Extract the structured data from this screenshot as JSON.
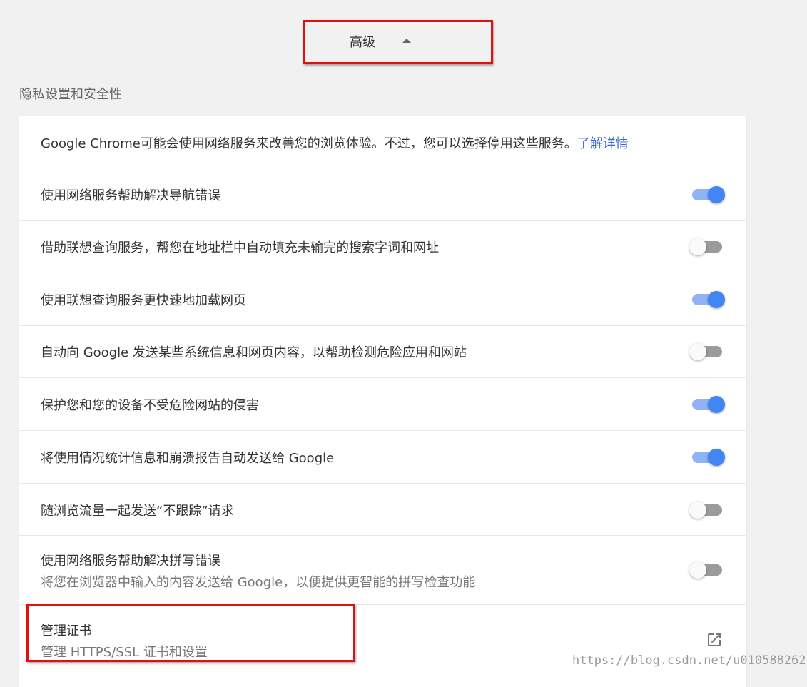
{
  "advanced": {
    "label": "高级"
  },
  "section": {
    "title": "隐私设置和安全性"
  },
  "intro": {
    "text": "Google Chrome可能会使用网络服务来改善您的浏览体验。不过，您可以选择停用这些服务。",
    "link": "了解详情"
  },
  "settings": [
    {
      "label": "使用网络服务帮助解决导航错误",
      "enabled": true
    },
    {
      "label": "借助联想查询服务，帮您在地址栏中自动填充未输完的搜索字词和网址",
      "enabled": false
    },
    {
      "label": "使用联想查询服务更快速地加载网页",
      "enabled": true
    },
    {
      "label": "自动向 Google 发送某些系统信息和网页内容，以帮助检测危险应用和网站",
      "enabled": false
    },
    {
      "label": "保护您和您的设备不受危险网站的侵害",
      "enabled": true
    },
    {
      "label": "将使用情况统计信息和崩溃报告自动发送给 Google",
      "enabled": true
    },
    {
      "label": "随浏览流量一起发送“不跟踪”请求",
      "enabled": false
    },
    {
      "label": "使用网络服务帮助解决拼写错误",
      "sublabel": "将您在浏览器中输入的内容发送给 Google，以便提供更智能的拼写检查功能",
      "enabled": false
    }
  ],
  "certificates": {
    "label": "管理证书",
    "sublabel": "管理 HTTPS/SSL 证书和设置",
    "icon": "open-in-new-icon"
  },
  "watermark": "https://blog.csdn.net/u010588262",
  "colors": {
    "accent": "#4285f4",
    "link": "#3367d6",
    "highlight_border": "#e01010"
  }
}
